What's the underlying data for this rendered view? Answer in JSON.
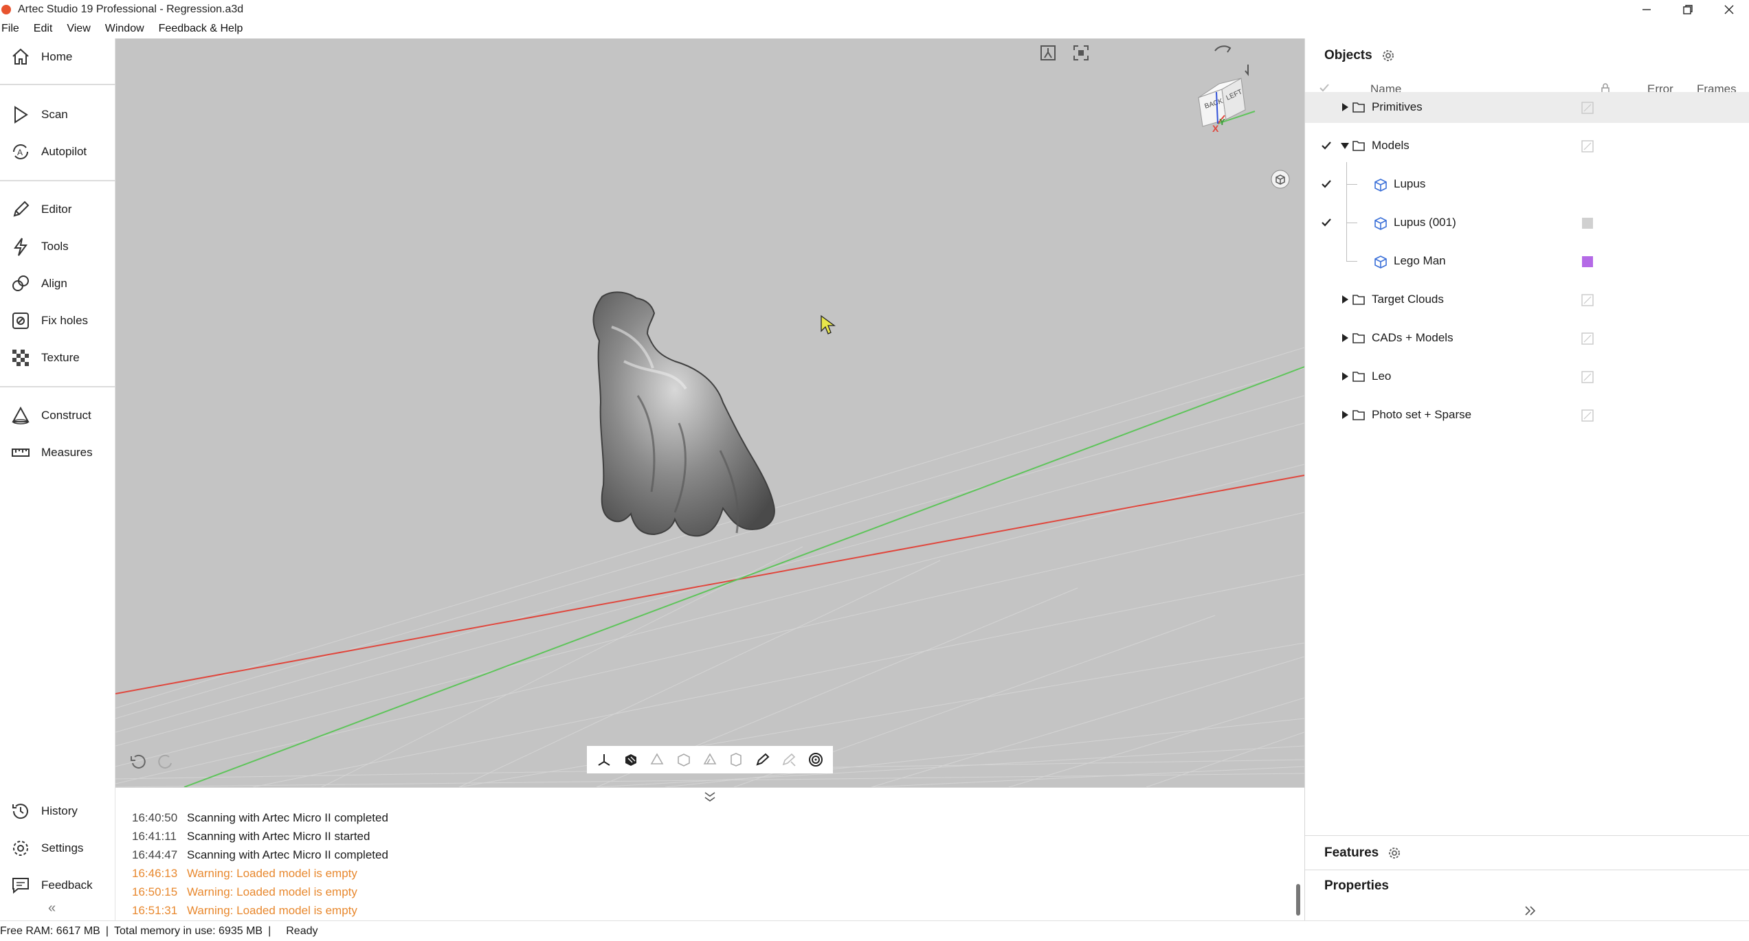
{
  "window": {
    "title": "Artec Studio 19 Professional - Regression.a3d",
    "controls": [
      "minimize-icon",
      "restore-icon",
      "close-icon"
    ]
  },
  "menu": [
    "File",
    "Edit",
    "View",
    "Window",
    "Feedback & Help"
  ],
  "sidebar": {
    "items": [
      {
        "label": "Home",
        "icon": "home-icon"
      },
      {
        "label": "Scan",
        "icon": "play-icon"
      },
      {
        "label": "Autopilot",
        "icon": "autopilot-icon"
      },
      {
        "label": "Editor",
        "icon": "pencil-icon"
      },
      {
        "label": "Tools",
        "icon": "lightning-icon"
      },
      {
        "label": "Align",
        "icon": "align-icon"
      },
      {
        "label": "Fix holes",
        "icon": "fix-holes-icon"
      },
      {
        "label": "Texture",
        "icon": "checker-icon"
      },
      {
        "label": "Construct",
        "icon": "cone-icon"
      },
      {
        "label": "Measures",
        "icon": "ruler-icon"
      },
      {
        "label": "History",
        "icon": "history-icon"
      },
      {
        "label": "Settings",
        "icon": "gear-icon"
      },
      {
        "label": "Feedback",
        "icon": "chat-icon"
      }
    ],
    "collapse_glyph": "«"
  },
  "viewport": {
    "background": "#c4c4c4",
    "view_cube_faces": [
      "BACK",
      "LEFT"
    ],
    "axis_labels": {
      "x": "X",
      "y": "Y"
    },
    "axis_colors": {
      "x": "#e0463c",
      "y": "#5ec45a",
      "z": "#3050d8"
    },
    "toolbar_icons": [
      "axes-icon",
      "solid-shading-icon",
      "flat-shading-icon",
      "wireframe-icon",
      "shading-mode-icon",
      "texture-icon",
      "edit-mode-icon",
      "disabled-mode-icon",
      "spiral-icon"
    ]
  },
  "log": {
    "entries": [
      {
        "time": "16:40:50",
        "text": "Scanning with Artec Micro II completed",
        "level": "info"
      },
      {
        "time": "16:41:11",
        "text": "Scanning with Artec Micro II started",
        "level": "info"
      },
      {
        "time": "16:44:47",
        "text": "Scanning with Artec Micro II completed",
        "level": "info"
      },
      {
        "time": "16:46:13",
        "text": "Warning: Loaded model is empty",
        "level": "warning"
      },
      {
        "time": "16:50:15",
        "text": "Warning: Loaded model is empty",
        "level": "warning"
      },
      {
        "time": "16:51:31",
        "text": "Warning: Loaded model is empty",
        "level": "warning"
      }
    ],
    "warning_color": "#e8882e"
  },
  "status": {
    "free_ram": "Free RAM: 6617 MB",
    "total_memory": "Total memory in use: 6935 MB",
    "state": "Ready",
    "separator": "|"
  },
  "objects": {
    "title": "Objects",
    "columns": {
      "name": "Name",
      "error": "Error",
      "frames": "Frames"
    },
    "rows": [
      {
        "label": "Primitives",
        "type": "folder",
        "expanded": false,
        "checked": false,
        "selected": true
      },
      {
        "label": "Models",
        "type": "folder",
        "expanded": true,
        "checked": true,
        "selected": false
      },
      {
        "label": "Lupus",
        "type": "object",
        "checked": true,
        "swatch": null
      },
      {
        "label": "Lupus (001)",
        "type": "object",
        "checked": true,
        "swatch": "#d0d0d0"
      },
      {
        "label": "Lego Man",
        "type": "object",
        "checked": false,
        "swatch": "#b46ae6"
      },
      {
        "label": "Target Clouds",
        "type": "folder",
        "expanded": false,
        "checked": false
      },
      {
        "label": "CADs + Models",
        "type": "folder",
        "expanded": false,
        "checked": false
      },
      {
        "label": "Leo",
        "type": "folder",
        "expanded": false,
        "checked": false
      },
      {
        "label": "Photo set + Sparse",
        "type": "folder",
        "expanded": false,
        "checked": false
      }
    ]
  },
  "features": {
    "title": "Features"
  },
  "properties": {
    "title": "Properties"
  }
}
